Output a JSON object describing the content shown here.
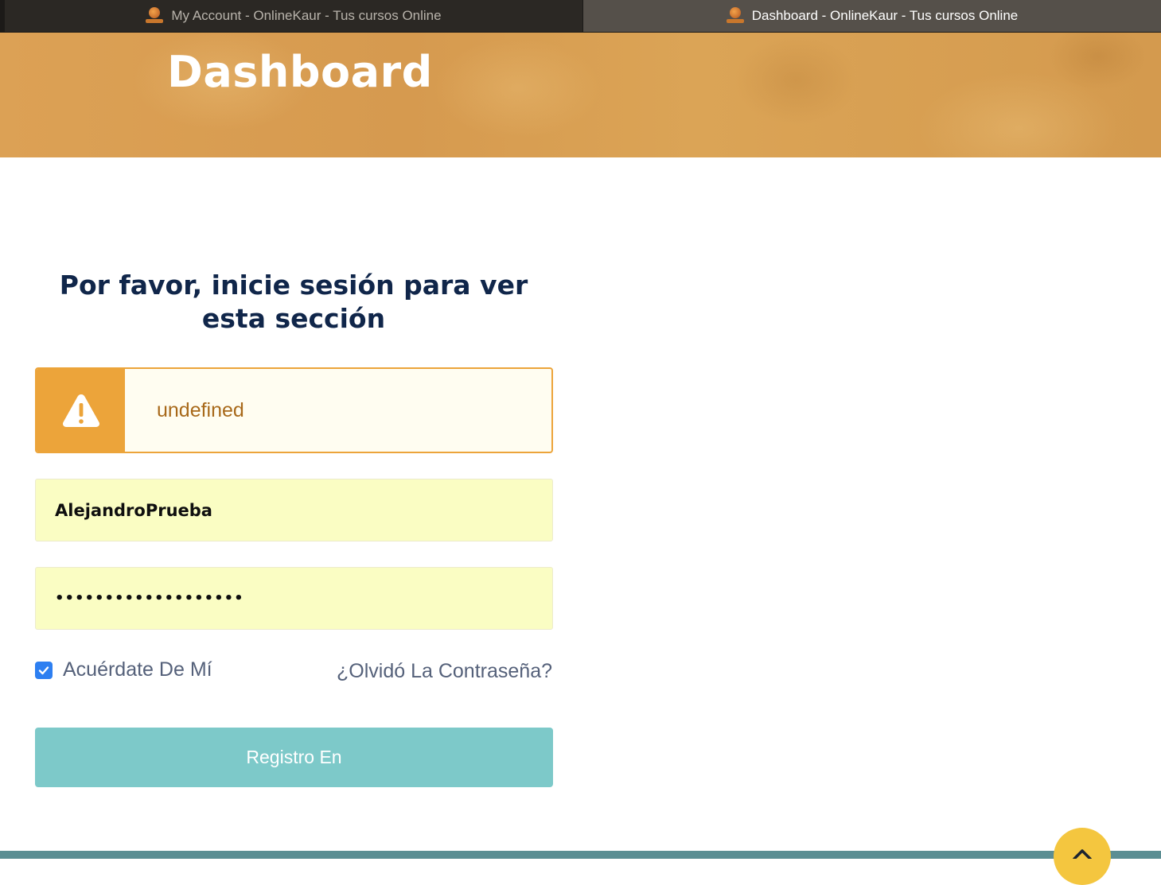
{
  "browser": {
    "tabs": [
      {
        "title": "My Account - OnlineKaur - Tus cursos Online",
        "active": false
      },
      {
        "title": "Dashboard - OnlineKaur - Tus cursos Online",
        "active": true
      }
    ],
    "favicon_icon": "onlinekaur-logo-icon"
  },
  "hero": {
    "title": "Dashboard",
    "background_color": "#d99e52"
  },
  "login": {
    "heading": "Por favor, inicie sesión para ver esta sección",
    "notice": {
      "icon": "warning-icon",
      "message": "undefined",
      "accent_color": "#eca43a"
    },
    "username": {
      "value": "AlejandroPrueba"
    },
    "password": {
      "value": "•••••••••••••••••••"
    },
    "remember_me": {
      "label": "Acuérdate De Mí",
      "checked": true
    },
    "forgot_password_label": "¿Olvidó La Contraseña?",
    "submit_label": "Registro En",
    "submit_color": "#7dc9c9"
  },
  "scroll_top": {
    "icon": "chevron-up-icon",
    "color": "#f4c63f"
  }
}
